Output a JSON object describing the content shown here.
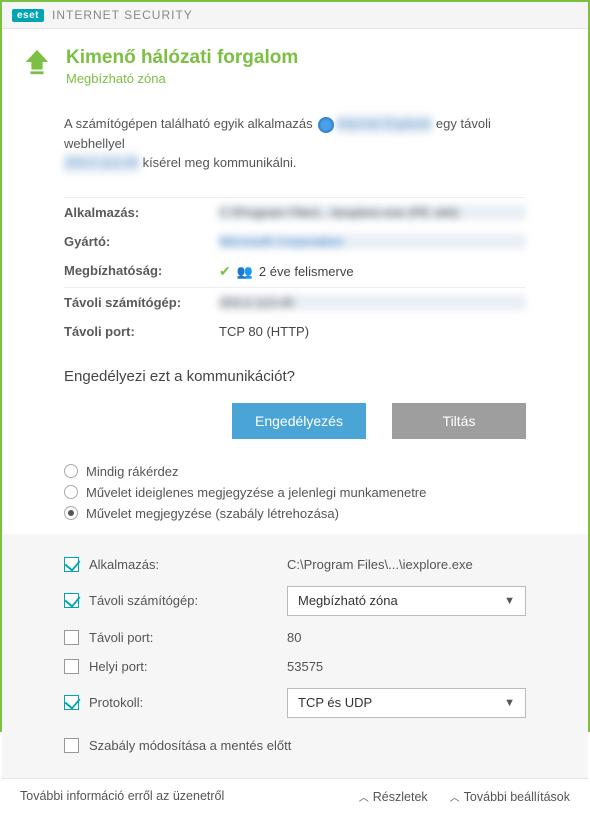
{
  "titlebar": {
    "brand": "eset",
    "product": "INTERNET SECURITY"
  },
  "header": {
    "title": "Kimenő hálózati forgalom",
    "subtitle": "Megbízható zóna"
  },
  "intro": {
    "pre": "A számítógépen található egyik alkalmazás ",
    "app_redacted": "Internet Explorer",
    "mid": " egy távoli webhellyel ",
    "host_redacted": "203.0.113.45",
    "post": " kísérel meg kommunikálni."
  },
  "info": {
    "app_label": "Alkalmazás:",
    "app_value": "C:\\Program Files\\...\\iexplore.exe (PE x64)",
    "vendor_label": "Gyártó:",
    "vendor_value": "Microsoft Corporation",
    "trust_label": "Megbízhatóság:",
    "trust_value": "2 éve felismerve",
    "remote_label": "Távoli számítógép:",
    "remote_value": "203.0.113.45",
    "port_label": "Távoli port:",
    "port_value": "TCP 80 (HTTP)"
  },
  "question": "Engedélyezi ezt a kommunikációt?",
  "buttons": {
    "allow": "Engedélyezés",
    "deny": "Tiltás"
  },
  "radios": {
    "always_ask": "Mindig rákérdez",
    "temp_remember": "Művelet ideiglenes megjegyzése a jelenlegi munkamenetre",
    "create_rule": "Művelet megjegyzése (szabály létrehozása)"
  },
  "rules": {
    "app_label": "Alkalmazás:",
    "app_value": "C:\\Program Files\\...\\iexplore.exe",
    "remote_label": "Távoli számítógép:",
    "remote_select": "Megbízható zóna",
    "rport_label": "Távoli port:",
    "rport_value": "80",
    "lport_label": "Helyi port:",
    "lport_value": "53575",
    "proto_label": "Protokoll:",
    "proto_select": "TCP és UDP",
    "modify_before_save": "Szabály módosítása a mentés előtt"
  },
  "footer": {
    "more_info": "További információ erről az üzenetről",
    "details": "Részletek",
    "more_settings": "További beállítások"
  }
}
